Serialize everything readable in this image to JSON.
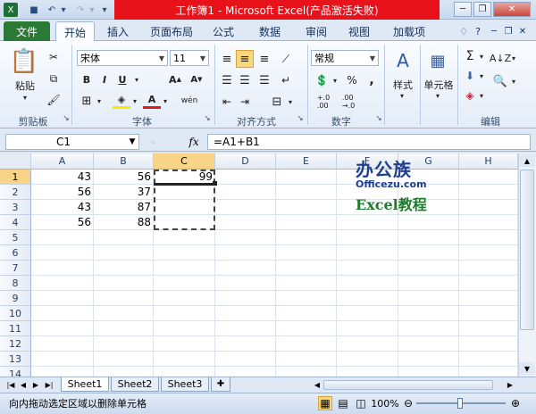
{
  "window": {
    "title": "工作簿1 - Microsoft Excel(产品激活失败)"
  },
  "tabs": [
    "文件",
    "开始",
    "插入",
    "页面布局",
    "公式",
    "数据",
    "审阅",
    "视图",
    "加载项"
  ],
  "ribbon": {
    "paste_label": "粘贴",
    "font_name": "宋体",
    "font_size": "11",
    "number_format": "常规",
    "style_label": "样式",
    "cells_label": "单元格",
    "groups": [
      "剪贴板",
      "字体",
      "对齐方式",
      "数字",
      "编辑"
    ]
  },
  "formula": {
    "namebox": "C1",
    "fx": "fx",
    "content": "=A1+B1"
  },
  "columns": [
    "A",
    "B",
    "C",
    "D",
    "E",
    "F",
    "G",
    "H"
  ],
  "rows": [
    "1",
    "2",
    "3",
    "4",
    "5",
    "6",
    "7",
    "8",
    "9",
    "10",
    "11",
    "12",
    "13",
    "14"
  ],
  "cells": {
    "A1": "43",
    "B1": "56",
    "C1": "99",
    "A2": "56",
    "B2": "37",
    "A3": "43",
    "B3": "87",
    "A4": "56",
    "B4": "88"
  },
  "watermark": {
    "brand_cn": "办公族",
    "brand_url": "Officezu.com",
    "tagline": "Excel教程"
  },
  "sheets": [
    "Sheet1",
    "Sheet2",
    "Sheet3"
  ],
  "status": {
    "message": "向内拖动选定区域以删除单元格",
    "zoom": "100%"
  }
}
